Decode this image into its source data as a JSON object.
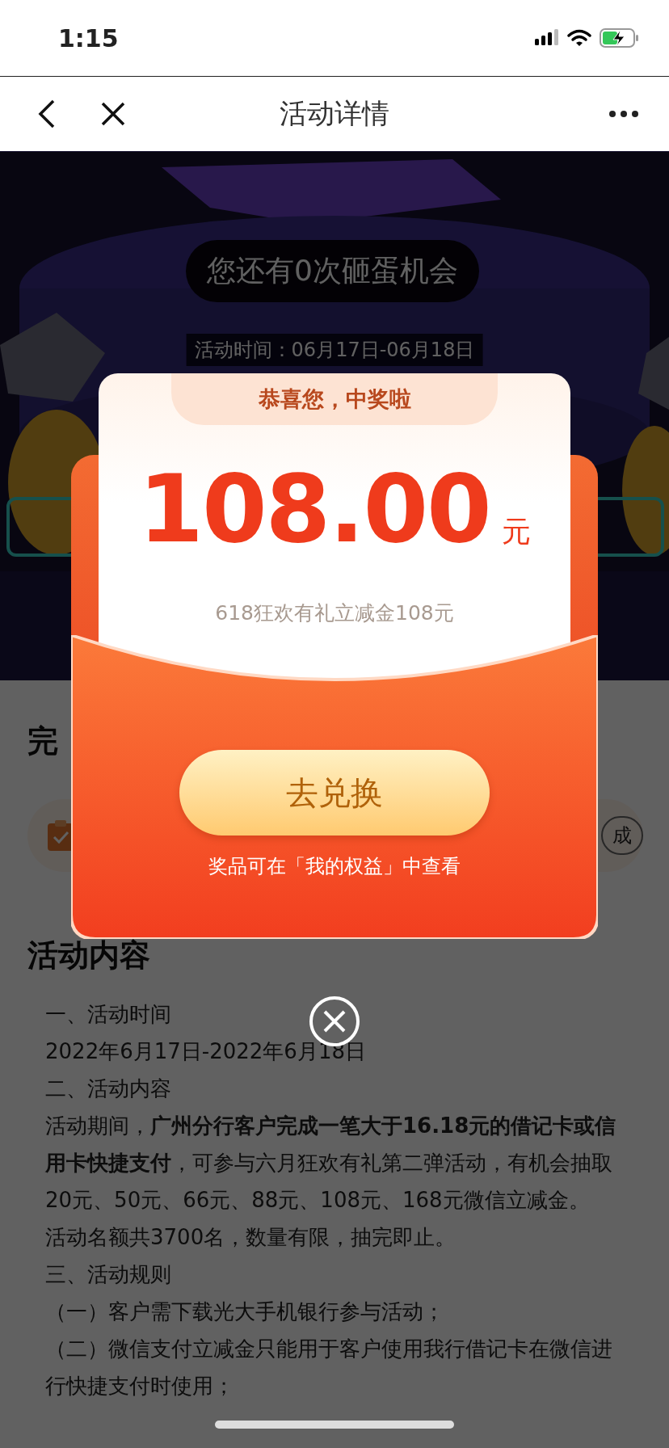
{
  "status_bar": {
    "time": "1:15"
  },
  "nav_bar": {
    "title": "活动详情"
  },
  "banner": {
    "chances": "您还有0次砸蛋机会",
    "activity_time": "活动时间：06月17日-06月18日"
  },
  "tasks_section": {
    "heading": "完",
    "task": {
      "status": "成"
    }
  },
  "content_section": {
    "heading": "活动内容",
    "paragraphs": [
      "一、活动时间",
      "2022年6月17日-2022年6月18日",
      "二、活动内容",
      "活动期间，**广州分行客户完成一笔大于16.18元的借记卡或信用卡快捷支付**，可参与六月狂欢有礼第二弹活动，有机会抽取20元、50元、66元、88元、108元、168元微信立减金。",
      "活动名额共3700名，数量有限，抽完即止。",
      "三、活动规则",
      "（一）客户需下载光大手机银行参与活动；",
      "（二）微信支付立减金只能用于客户使用我行借记卡在微信进行快捷支付时使用；"
    ]
  },
  "prize_dialog": {
    "title": "恭喜您，中奖啦",
    "amount": "108.00",
    "unit": "元",
    "description": "618狂欢有礼立减金108元",
    "redeem_button": "去兑换",
    "note": "奖品可在「我的权益」中查看"
  }
}
